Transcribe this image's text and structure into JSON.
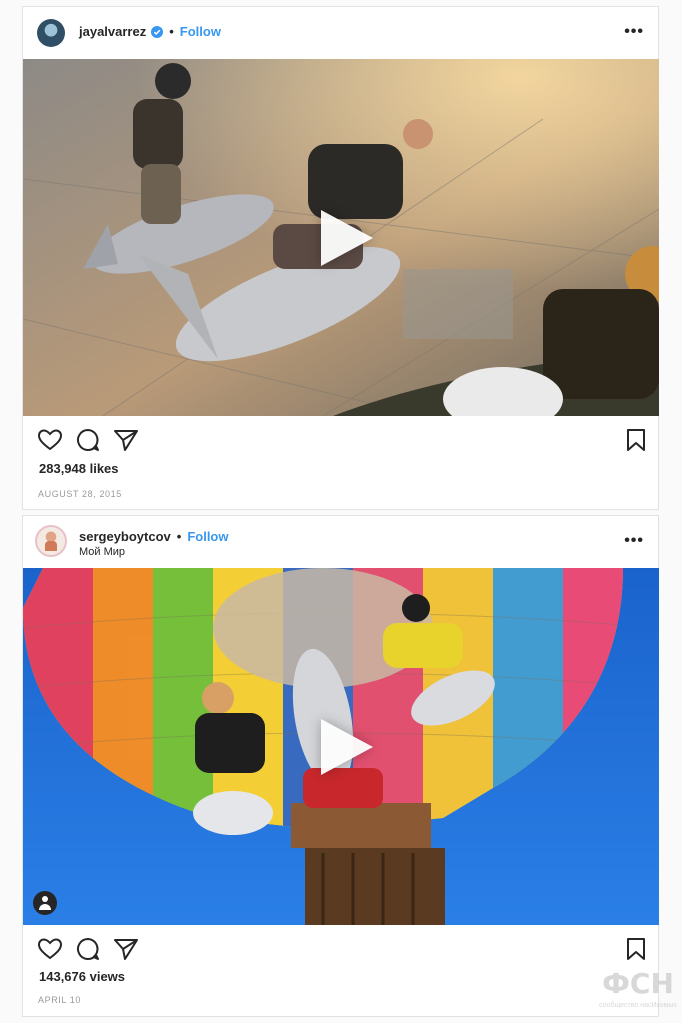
{
  "posts": [
    {
      "username": "jayalvarrez",
      "verified": true,
      "follow_label": "Follow",
      "subtitle": "",
      "likes": "283,948 likes",
      "date": "AUGUST 28, 2015",
      "media_type": "video",
      "icons": [
        "heart-icon",
        "comment-icon",
        "share-icon",
        "bookmark-icon",
        "more-icon",
        "play-icon"
      ]
    },
    {
      "username": "sergeyboytcov",
      "verified": false,
      "follow_label": "Follow",
      "subtitle": "Мой Мир",
      "likes": "143,676 views",
      "date": "APRIL 10",
      "media_type": "video",
      "icons": [
        "heart-icon",
        "comment-icon",
        "share-icon",
        "bookmark-icon",
        "more-icon",
        "play-icon",
        "user-tag-icon"
      ]
    }
  ],
  "separator_dot": "•",
  "more_glyph": "•••",
  "watermark": {
    "logo": "ФСН",
    "caption": "сообщество насИкомых"
  },
  "colors": {
    "follow": "#3897f0",
    "verified": "#3897f0",
    "text": "#262626",
    "date": "#999999",
    "sky": "#1f6fd6"
  }
}
